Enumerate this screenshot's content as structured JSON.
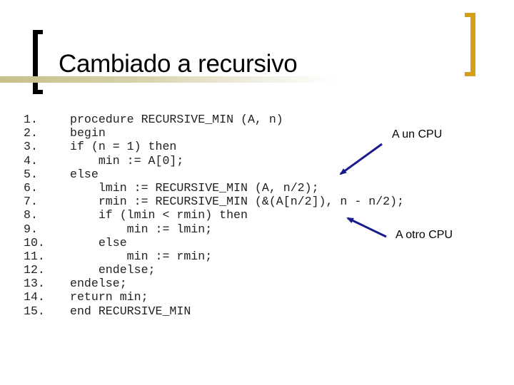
{
  "slide": {
    "title": "Cambiado a recursivo",
    "code_lines": [
      {
        "num": "1.",
        "text": "procedure RECURSIVE_MIN (A, n)"
      },
      {
        "num": "2.",
        "text": "begin"
      },
      {
        "num": "3.",
        "text": "if (n = 1) then"
      },
      {
        "num": "4.",
        "text": "    min := A[0];"
      },
      {
        "num": "5.",
        "text": "else"
      },
      {
        "num": "6.",
        "text": "    lmin := RECURSIVE_MIN (A, n/2);"
      },
      {
        "num": "7.",
        "text": "    rmin := RECURSIVE_MIN (&(A[n/2]), n - n/2);"
      },
      {
        "num": "8.",
        "text": "    if (lmin < rmin) then"
      },
      {
        "num": "9.",
        "text": "        min := lmin;"
      },
      {
        "num": "10.",
        "text": "    else"
      },
      {
        "num": "11.",
        "text": "        min := rmin;"
      },
      {
        "num": "12.",
        "text": "    endelse;"
      },
      {
        "num": "13.",
        "text": "endelse;"
      },
      {
        "num": "14.",
        "text": "return min;"
      },
      {
        "num": "15.",
        "text": "end RECURSIVE_MIN"
      }
    ],
    "annotations": {
      "first": "A un CPU",
      "second": "A otro CPU"
    },
    "colors": {
      "arrow": "#1a1a8c",
      "right_bracket": "#d4a017",
      "title_bar": "#c7c08a"
    }
  }
}
